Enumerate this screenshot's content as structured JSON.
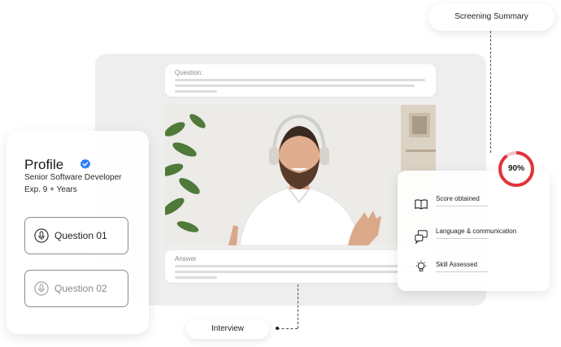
{
  "question_card": {
    "label": "Question:"
  },
  "answer_card": {
    "label": "Answer"
  },
  "profile": {
    "title": "Profile",
    "role": "Senior Software Developer",
    "experience": "Exp. 9 + Years",
    "questions": [
      {
        "label": "Question 01",
        "state": "active"
      },
      {
        "label": "Question 02",
        "state": "inactive"
      }
    ]
  },
  "score_card": {
    "percentage_label": "90%",
    "percentage_value": 0.9,
    "ring_color": "#e2333a",
    "items": [
      {
        "label": "Score obtained",
        "icon": "book-icon"
      },
      {
        "label": "Language & communication",
        "icon": "chat-bubbles-icon"
      },
      {
        "label": "Skill Assessed",
        "icon": "lightbulb-icon"
      }
    ]
  },
  "labels": {
    "screening_summary": "Screening Summary",
    "interview": "Interview"
  },
  "colors": {
    "verified": "#2d7ff9",
    "accent_red": "#e2333a"
  }
}
